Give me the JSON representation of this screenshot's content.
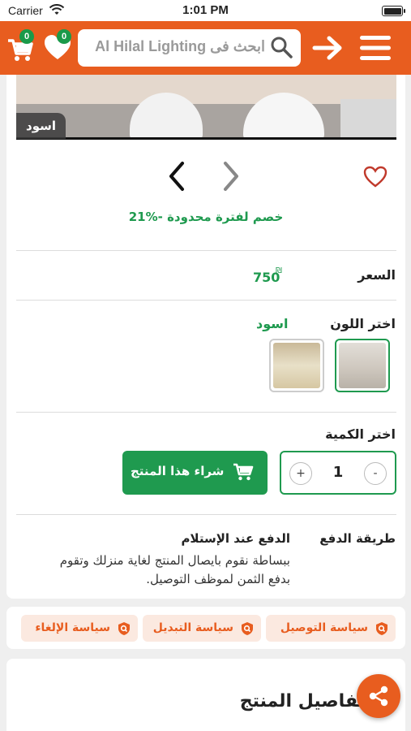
{
  "status_bar": {
    "carrier": "Carrier",
    "time": "1:01 PM"
  },
  "header": {
    "cart_count": "0",
    "favorites_count": "0",
    "search_placeholder": "ابحث فى Al Hilal Lighting",
    "accent_color": "#e85d1f"
  },
  "product": {
    "image_color_tag": "اسود",
    "discount_text": "21%- خصم لفترة محدودة",
    "price_label": "السعر",
    "price_value": "750",
    "currency": "₪",
    "color_label": "اختر اللون",
    "selected_color": "اسود",
    "quantity_label": "اختر الكمية",
    "quantity": "1",
    "qty_plus": "+",
    "qty_minus": "-",
    "buy_label": "شراء هذا المنتج",
    "payment_label": "طريقة الدفع",
    "payment_title": "الدفع عند الإستلام",
    "payment_desc": "ببساطة نقوم بايصال المنتج لغاية منزلك وتقوم بدفع الثمن لموظف التوصيل."
  },
  "policies": [
    {
      "label": "سياسة التوصيل"
    },
    {
      "label": "سياسة التبديل"
    },
    {
      "label": "سياسة الإلغاء"
    }
  ],
  "details": {
    "title": "تفاصيل المنتج"
  },
  "colors": {
    "accent": "#e85d1f",
    "green": "#1f9a4f"
  }
}
